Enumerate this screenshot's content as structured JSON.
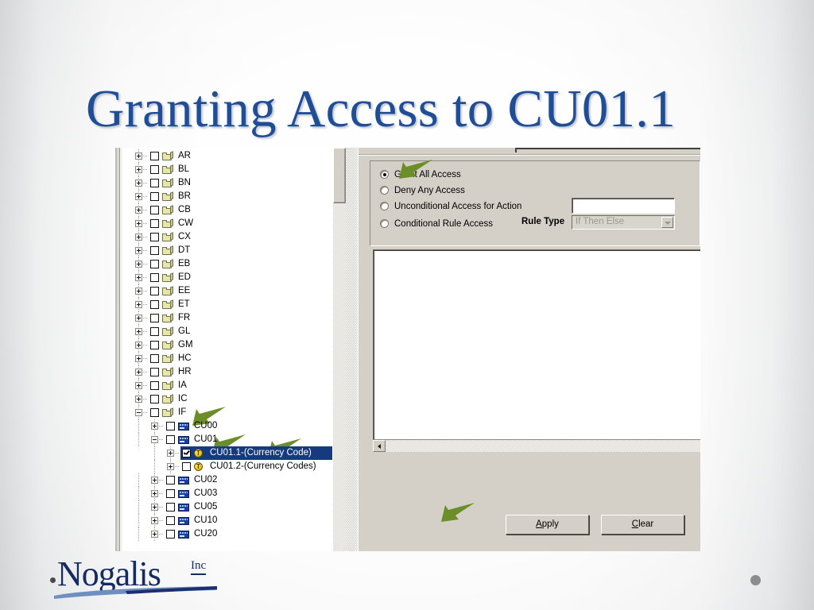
{
  "slide": {
    "title": "Granting Access to CU01.1",
    "accent_color": "#1f4e96",
    "arrow_color": "#6b8e28",
    "decorative_dot": "●"
  },
  "logo": {
    "name": "Nogalis",
    "suffix": "Inc",
    "bullet": "•"
  },
  "tree": {
    "rows": [
      {
        "label": "AR",
        "indent": 0,
        "expander": "plus",
        "checked": false,
        "icon": "folder-icon",
        "selected": false
      },
      {
        "label": "BL",
        "indent": 0,
        "expander": "plus",
        "checked": false,
        "icon": "folder-icon",
        "selected": false
      },
      {
        "label": "BN",
        "indent": 0,
        "expander": "plus",
        "checked": false,
        "icon": "folder-icon",
        "selected": false
      },
      {
        "label": "BR",
        "indent": 0,
        "expander": "plus",
        "checked": false,
        "icon": "folder-icon",
        "selected": false
      },
      {
        "label": "CB",
        "indent": 0,
        "expander": "plus",
        "checked": false,
        "icon": "folder-icon",
        "selected": false
      },
      {
        "label": "CW",
        "indent": 0,
        "expander": "plus",
        "checked": false,
        "icon": "folder-icon",
        "selected": false
      },
      {
        "label": "CX",
        "indent": 0,
        "expander": "plus",
        "checked": false,
        "icon": "folder-icon",
        "selected": false
      },
      {
        "label": "DT",
        "indent": 0,
        "expander": "plus",
        "checked": false,
        "icon": "folder-icon",
        "selected": false
      },
      {
        "label": "EB",
        "indent": 0,
        "expander": "plus",
        "checked": false,
        "icon": "folder-icon",
        "selected": false
      },
      {
        "label": "ED",
        "indent": 0,
        "expander": "plus",
        "checked": false,
        "icon": "folder-icon",
        "selected": false
      },
      {
        "label": "EE",
        "indent": 0,
        "expander": "plus",
        "checked": false,
        "icon": "folder-icon",
        "selected": false
      },
      {
        "label": "ET",
        "indent": 0,
        "expander": "plus",
        "checked": false,
        "icon": "folder-icon",
        "selected": false
      },
      {
        "label": "FR",
        "indent": 0,
        "expander": "plus",
        "checked": false,
        "icon": "folder-icon",
        "selected": false
      },
      {
        "label": "GL",
        "indent": 0,
        "expander": "plus",
        "checked": false,
        "icon": "folder-icon",
        "selected": false
      },
      {
        "label": "GM",
        "indent": 0,
        "expander": "plus",
        "checked": false,
        "icon": "folder-icon",
        "selected": false
      },
      {
        "label": "HC",
        "indent": 0,
        "expander": "plus",
        "checked": false,
        "icon": "folder-icon",
        "selected": false
      },
      {
        "label": "HR",
        "indent": 0,
        "expander": "plus",
        "checked": false,
        "icon": "folder-icon",
        "selected": false
      },
      {
        "label": "IA",
        "indent": 0,
        "expander": "plus",
        "checked": false,
        "icon": "folder-icon",
        "selected": false
      },
      {
        "label": "IC",
        "indent": 0,
        "expander": "plus",
        "checked": false,
        "icon": "folder-icon",
        "selected": false
      },
      {
        "label": "IF",
        "indent": 0,
        "expander": "minus",
        "checked": false,
        "icon": "folder-icon",
        "selected": false
      },
      {
        "label": "CU00",
        "indent": 1,
        "expander": "plus",
        "checked": false,
        "icon": "form-icon",
        "selected": false
      },
      {
        "label": "CU01",
        "indent": 1,
        "expander": "minus",
        "checked": false,
        "icon": "form-icon",
        "selected": false
      },
      {
        "label": "CU01.1-(Currency Code)",
        "indent": 2,
        "expander": "plus",
        "checked": true,
        "icon": "token-icon",
        "selected": true
      },
      {
        "label": "CU01.2-(Currency Codes)",
        "indent": 2,
        "expander": "plus",
        "checked": false,
        "icon": "token-icon",
        "selected": false
      },
      {
        "label": "CU02",
        "indent": 1,
        "expander": "plus",
        "checked": false,
        "icon": "form-icon",
        "selected": false
      },
      {
        "label": "CU03",
        "indent": 1,
        "expander": "plus",
        "checked": false,
        "icon": "form-icon",
        "selected": false
      },
      {
        "label": "CU05",
        "indent": 1,
        "expander": "plus",
        "checked": false,
        "icon": "form-icon",
        "selected": false
      },
      {
        "label": "CU10",
        "indent": 1,
        "expander": "plus",
        "checked": false,
        "icon": "form-icon",
        "selected": false
      },
      {
        "label": "CU20",
        "indent": 1,
        "expander": "plus",
        "checked": false,
        "icon": "form-icon",
        "selected": false
      }
    ],
    "selection_color": "#163a80"
  },
  "dialog": {
    "access_options": [
      {
        "label": "Grant All Access",
        "selected": true
      },
      {
        "label": "Deny Any Access",
        "selected": false
      },
      {
        "label": "Unconditional Access for Action",
        "selected": false
      },
      {
        "label": "Conditional Rule Access",
        "selected": false
      }
    ],
    "action_field": {
      "value": "",
      "placeholder": ""
    },
    "rule_type_label": "Rule Type",
    "rule_type": {
      "value": "If Then Else",
      "disabled": true
    },
    "buttons": {
      "apply": {
        "accel": "A",
        "rest": "pply"
      },
      "clear": {
        "accel": "C",
        "rest": "lear"
      }
    }
  }
}
